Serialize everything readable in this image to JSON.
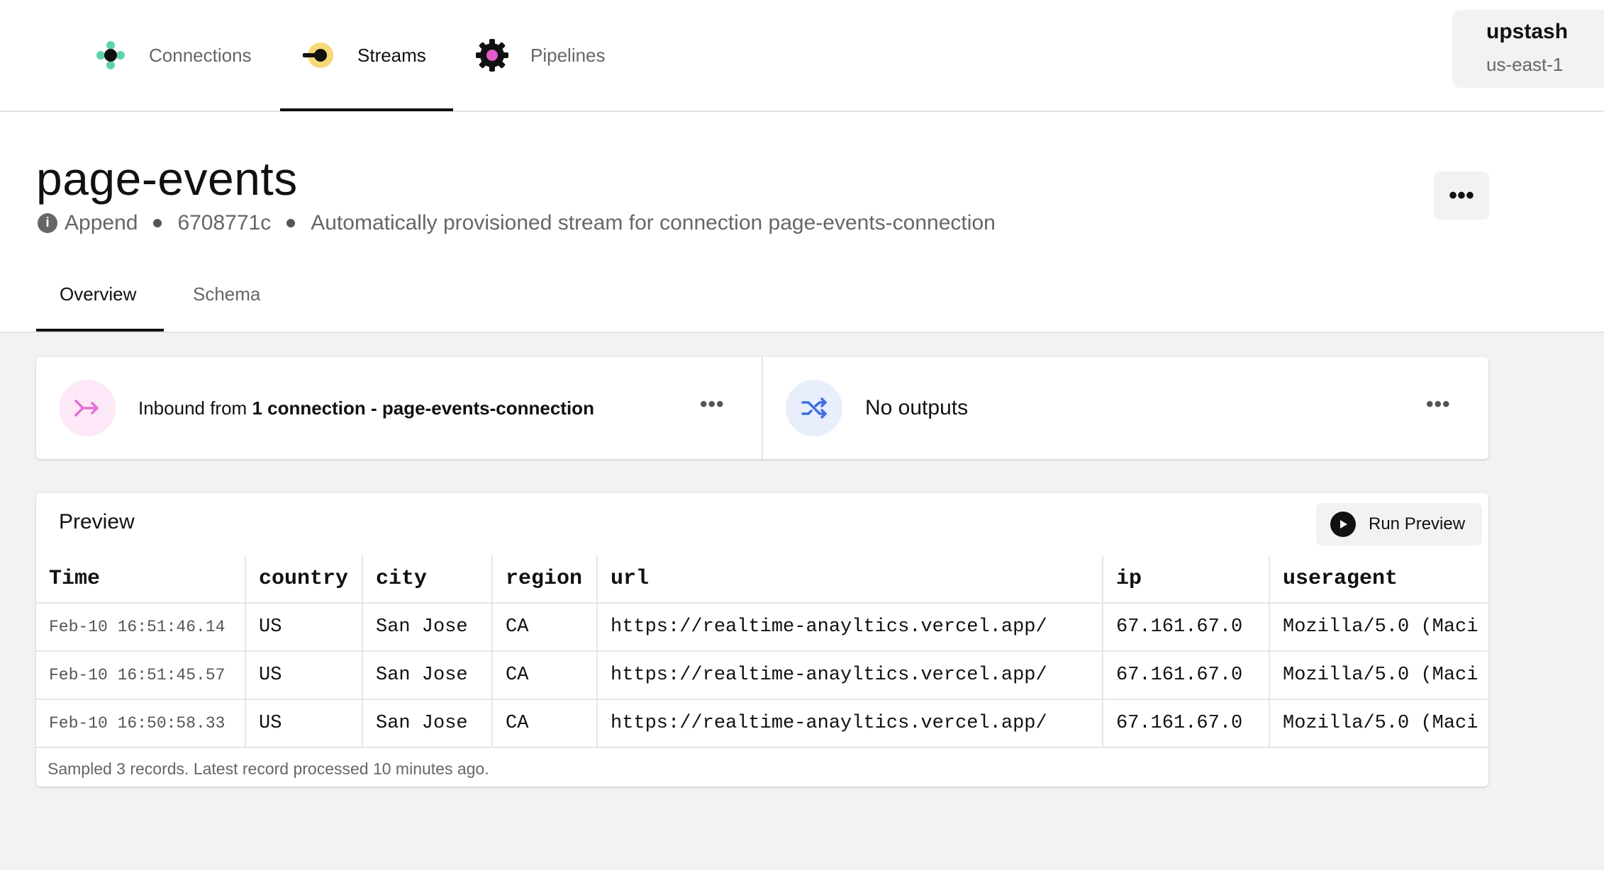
{
  "nav": {
    "items": [
      {
        "label": "Connections"
      },
      {
        "label": "Streams"
      },
      {
        "label": "Pipelines"
      }
    ],
    "active": "Streams"
  },
  "account": {
    "org": "upstash",
    "region": "us-east-1"
  },
  "stream": {
    "name": "page-events",
    "mode": "Append",
    "id": "6708771c",
    "description": "Automatically provisioned stream for connection page-events-connection"
  },
  "menu": {
    "more": "•••"
  },
  "tabs": [
    {
      "label": "Overview"
    },
    {
      "label": "Schema"
    }
  ],
  "inbound": {
    "prefix": "Inbound from ",
    "count": "1 connection - page-events-connection"
  },
  "outputs": {
    "label": "No outputs"
  },
  "card_more": "•••",
  "preview": {
    "title": "Preview",
    "run_label": "Run Preview",
    "columns": [
      "Time",
      "country",
      "city",
      "region",
      "url",
      "ip",
      "useragent"
    ],
    "rows": [
      [
        "Feb-10 16:51:46.14",
        "US",
        "San Jose",
        "CA",
        "https://realtime-anayltics.vercel.app/",
        "67.161.67.0",
        "Mozilla/5.0 (Maci"
      ],
      [
        "Feb-10 16:51:45.57",
        "US",
        "San Jose",
        "CA",
        "https://realtime-anayltics.vercel.app/",
        "67.161.67.0",
        "Mozilla/5.0 (Maci"
      ],
      [
        "Feb-10 16:50:58.33",
        "US",
        "San Jose",
        "CA",
        "https://realtime-anayltics.vercel.app/",
        "67.161.67.0",
        "Mozilla/5.0 (Maci"
      ]
    ],
    "footer": "Sampled 3 records.  Latest record processed 10 minutes ago."
  },
  "colors": {
    "connections_accent": "#5fd3a7",
    "streams_accent": "#f6d878",
    "pipelines_accent": "#e05cc9",
    "inbound_bg": "#fce8f7",
    "inbound_icon": "#e46fd6",
    "outputs_bg": "#e8eefc",
    "outputs_icon": "#3f6fe0"
  }
}
